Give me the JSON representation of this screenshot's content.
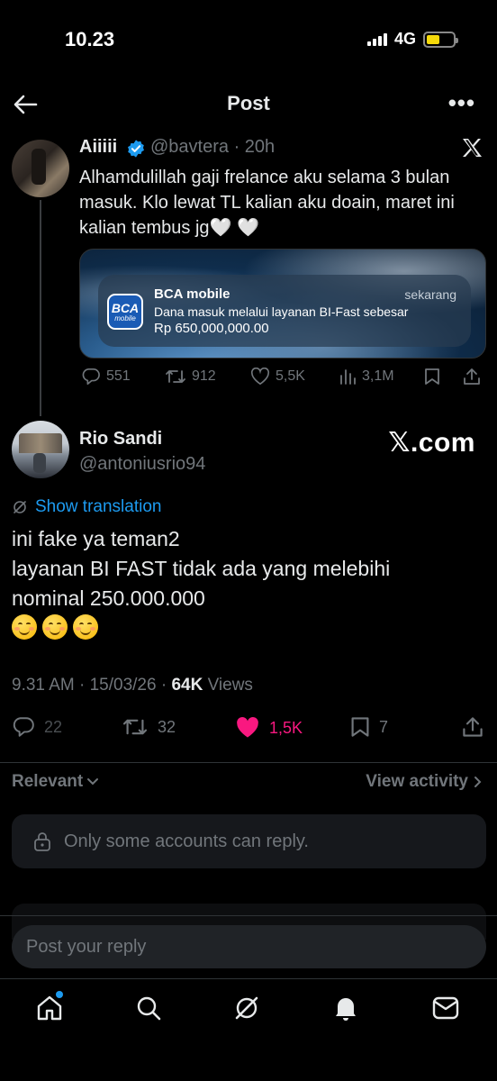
{
  "status_bar": {
    "time": "10.23",
    "network": "4G"
  },
  "header": {
    "title": "Post"
  },
  "quoted_post": {
    "name": "Aiiiii",
    "handle_time": "@bavtera · 20h",
    "text": "Alhamdulillah gaji frelance aku selama 3 bulan masuk. Klo lewat TL kalian aku doain, maret ini kalian tembus jg🤍 🤍",
    "notification": {
      "app_icon_text": "BCA",
      "app_icon_sub": "mobile",
      "app": "BCA mobile",
      "time": "sekarang",
      "line1": "Dana masuk melalui layanan BI-Fast sebesar",
      "line2": "Rp 650,000,000.00"
    },
    "stats": {
      "replies": "551",
      "reposts": "912",
      "likes": "5,5K",
      "views": "3,1M"
    }
  },
  "post": {
    "name": "Rio Sandi",
    "handle": "@antoniusrio94",
    "watermark": "𝕏.com",
    "translate_label": "Show translation",
    "text_lines": [
      "ini fake ya teman2",
      "layanan BI FAST tidak ada yang melebihi",
      "nominal 250.000.000"
    ],
    "timestamp": "9.31 AM · 15/03/26 · ",
    "views_count": "64K",
    "views_label": " Views",
    "stats": {
      "replies": "22",
      "reposts": "32",
      "likes": "1,5K",
      "bookmarks": "7"
    }
  },
  "replies_section": {
    "sort_label": "Relevant",
    "view_activity_label": "View activity",
    "restriction_text": "Only some accounts can reply."
  },
  "composer": {
    "placeholder": "Post your reply"
  },
  "colors": {
    "accent": "#1d9bf0",
    "like": "#f91880",
    "muted": "#71767b",
    "text": "#e7e9ea",
    "bg": "#000000"
  },
  "icons": [
    "back-arrow-icon",
    "more-icon",
    "verified-icon",
    "x-logo-icon",
    "reply-icon",
    "repost-icon",
    "like-icon",
    "views-icon",
    "bookmark-icon",
    "share-icon",
    "translate-icon",
    "chevron-down-icon",
    "chevron-right-icon",
    "lock-icon",
    "home-icon",
    "search-icon",
    "grok-icon",
    "notifications-icon",
    "messages-icon"
  ]
}
